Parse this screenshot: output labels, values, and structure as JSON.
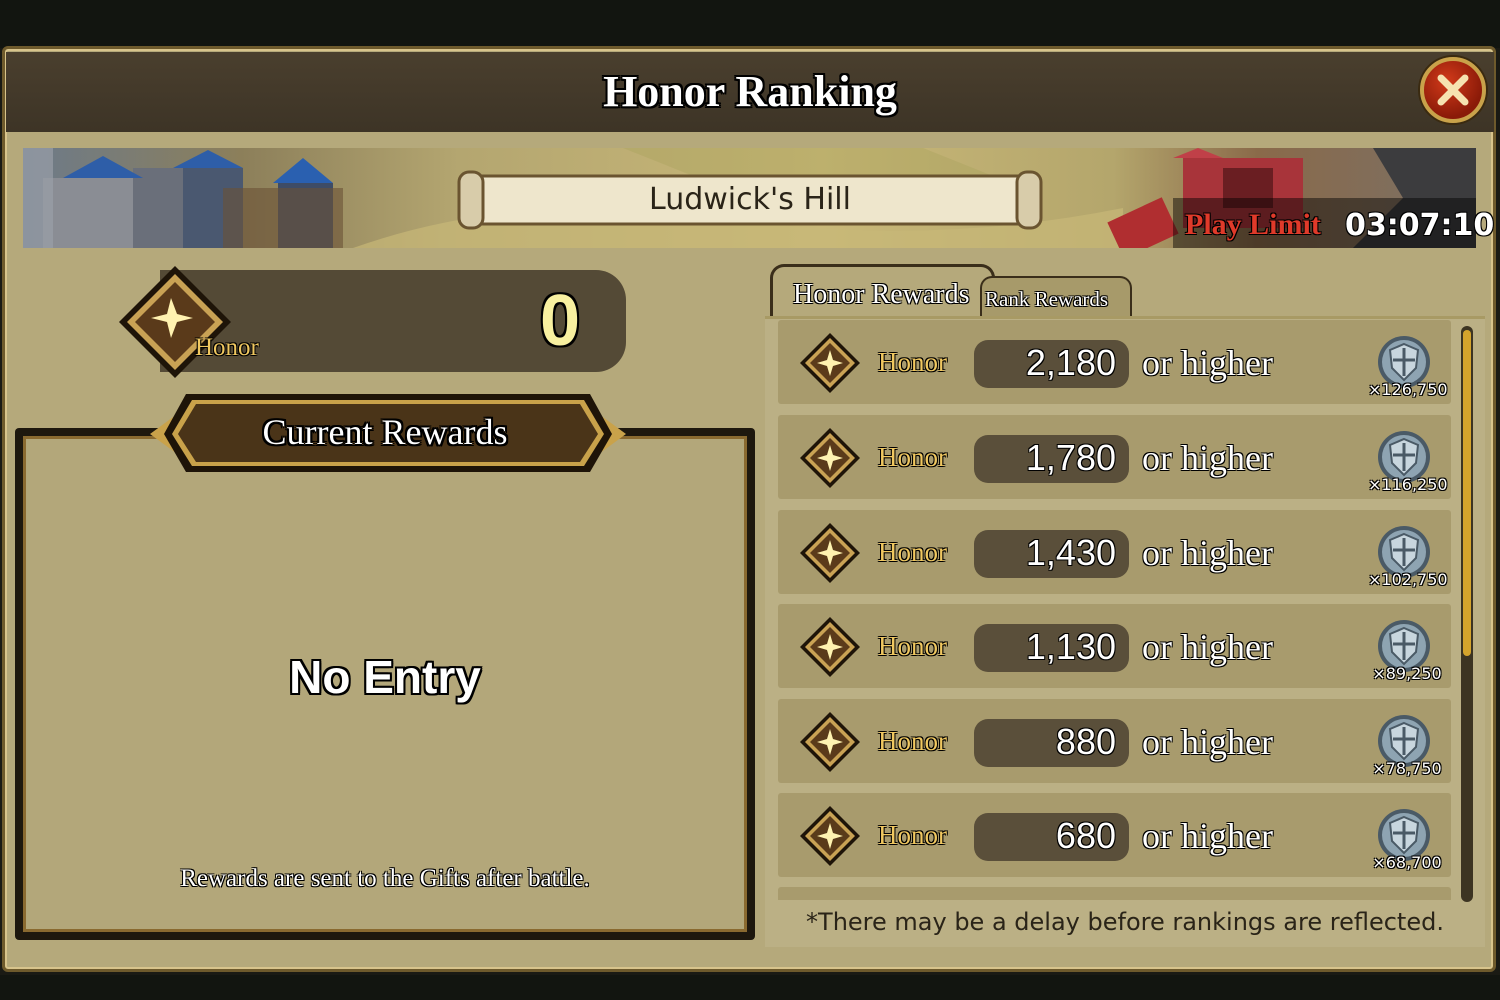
{
  "header": {
    "title": "Honor Ranking"
  },
  "banner": {
    "stage_name": "Ludwick's Hill",
    "play_limit_label": "Play Limit",
    "play_limit_time": "03:07:10"
  },
  "honor": {
    "label": "Honor",
    "value": "0"
  },
  "current_rewards": {
    "title": "Current Rewards",
    "empty_text": "No Entry",
    "note": "Rewards are sent to the Gifts after battle."
  },
  "tabs": [
    {
      "label": "Honor Rewards",
      "active": true
    },
    {
      "label": "Rank Rewards",
      "active": false
    }
  ],
  "reward_rows": [
    {
      "label": "Honor",
      "value": "2,180",
      "suffix": "or higher",
      "quantity": "×126,750"
    },
    {
      "label": "Honor",
      "value": "1,780",
      "suffix": "or higher",
      "quantity": "×116,250"
    },
    {
      "label": "Honor",
      "value": "1,430",
      "suffix": "or higher",
      "quantity": "×102,750"
    },
    {
      "label": "Honor",
      "value": "1,130",
      "suffix": "or higher",
      "quantity": "×89,250"
    },
    {
      "label": "Honor",
      "value": "880",
      "suffix": "or higher",
      "quantity": "×78,750"
    },
    {
      "label": "Honor",
      "value": "680",
      "suffix": "or higher",
      "quantity": "×68,700"
    }
  ],
  "footer_note": "*There may be a delay before rankings are reflected.",
  "icons": {
    "close": "close-icon",
    "honor": "honor-star-icon",
    "reward": "coin-icon"
  },
  "colors": {
    "panel": "#b5a97b",
    "dark_bar": "#4a3f2e",
    "honor_gold": "#f0c860",
    "play_limit_red": "#e03a2a",
    "close_red": "#c0301a",
    "scroll_gold": "#d4a42c"
  }
}
